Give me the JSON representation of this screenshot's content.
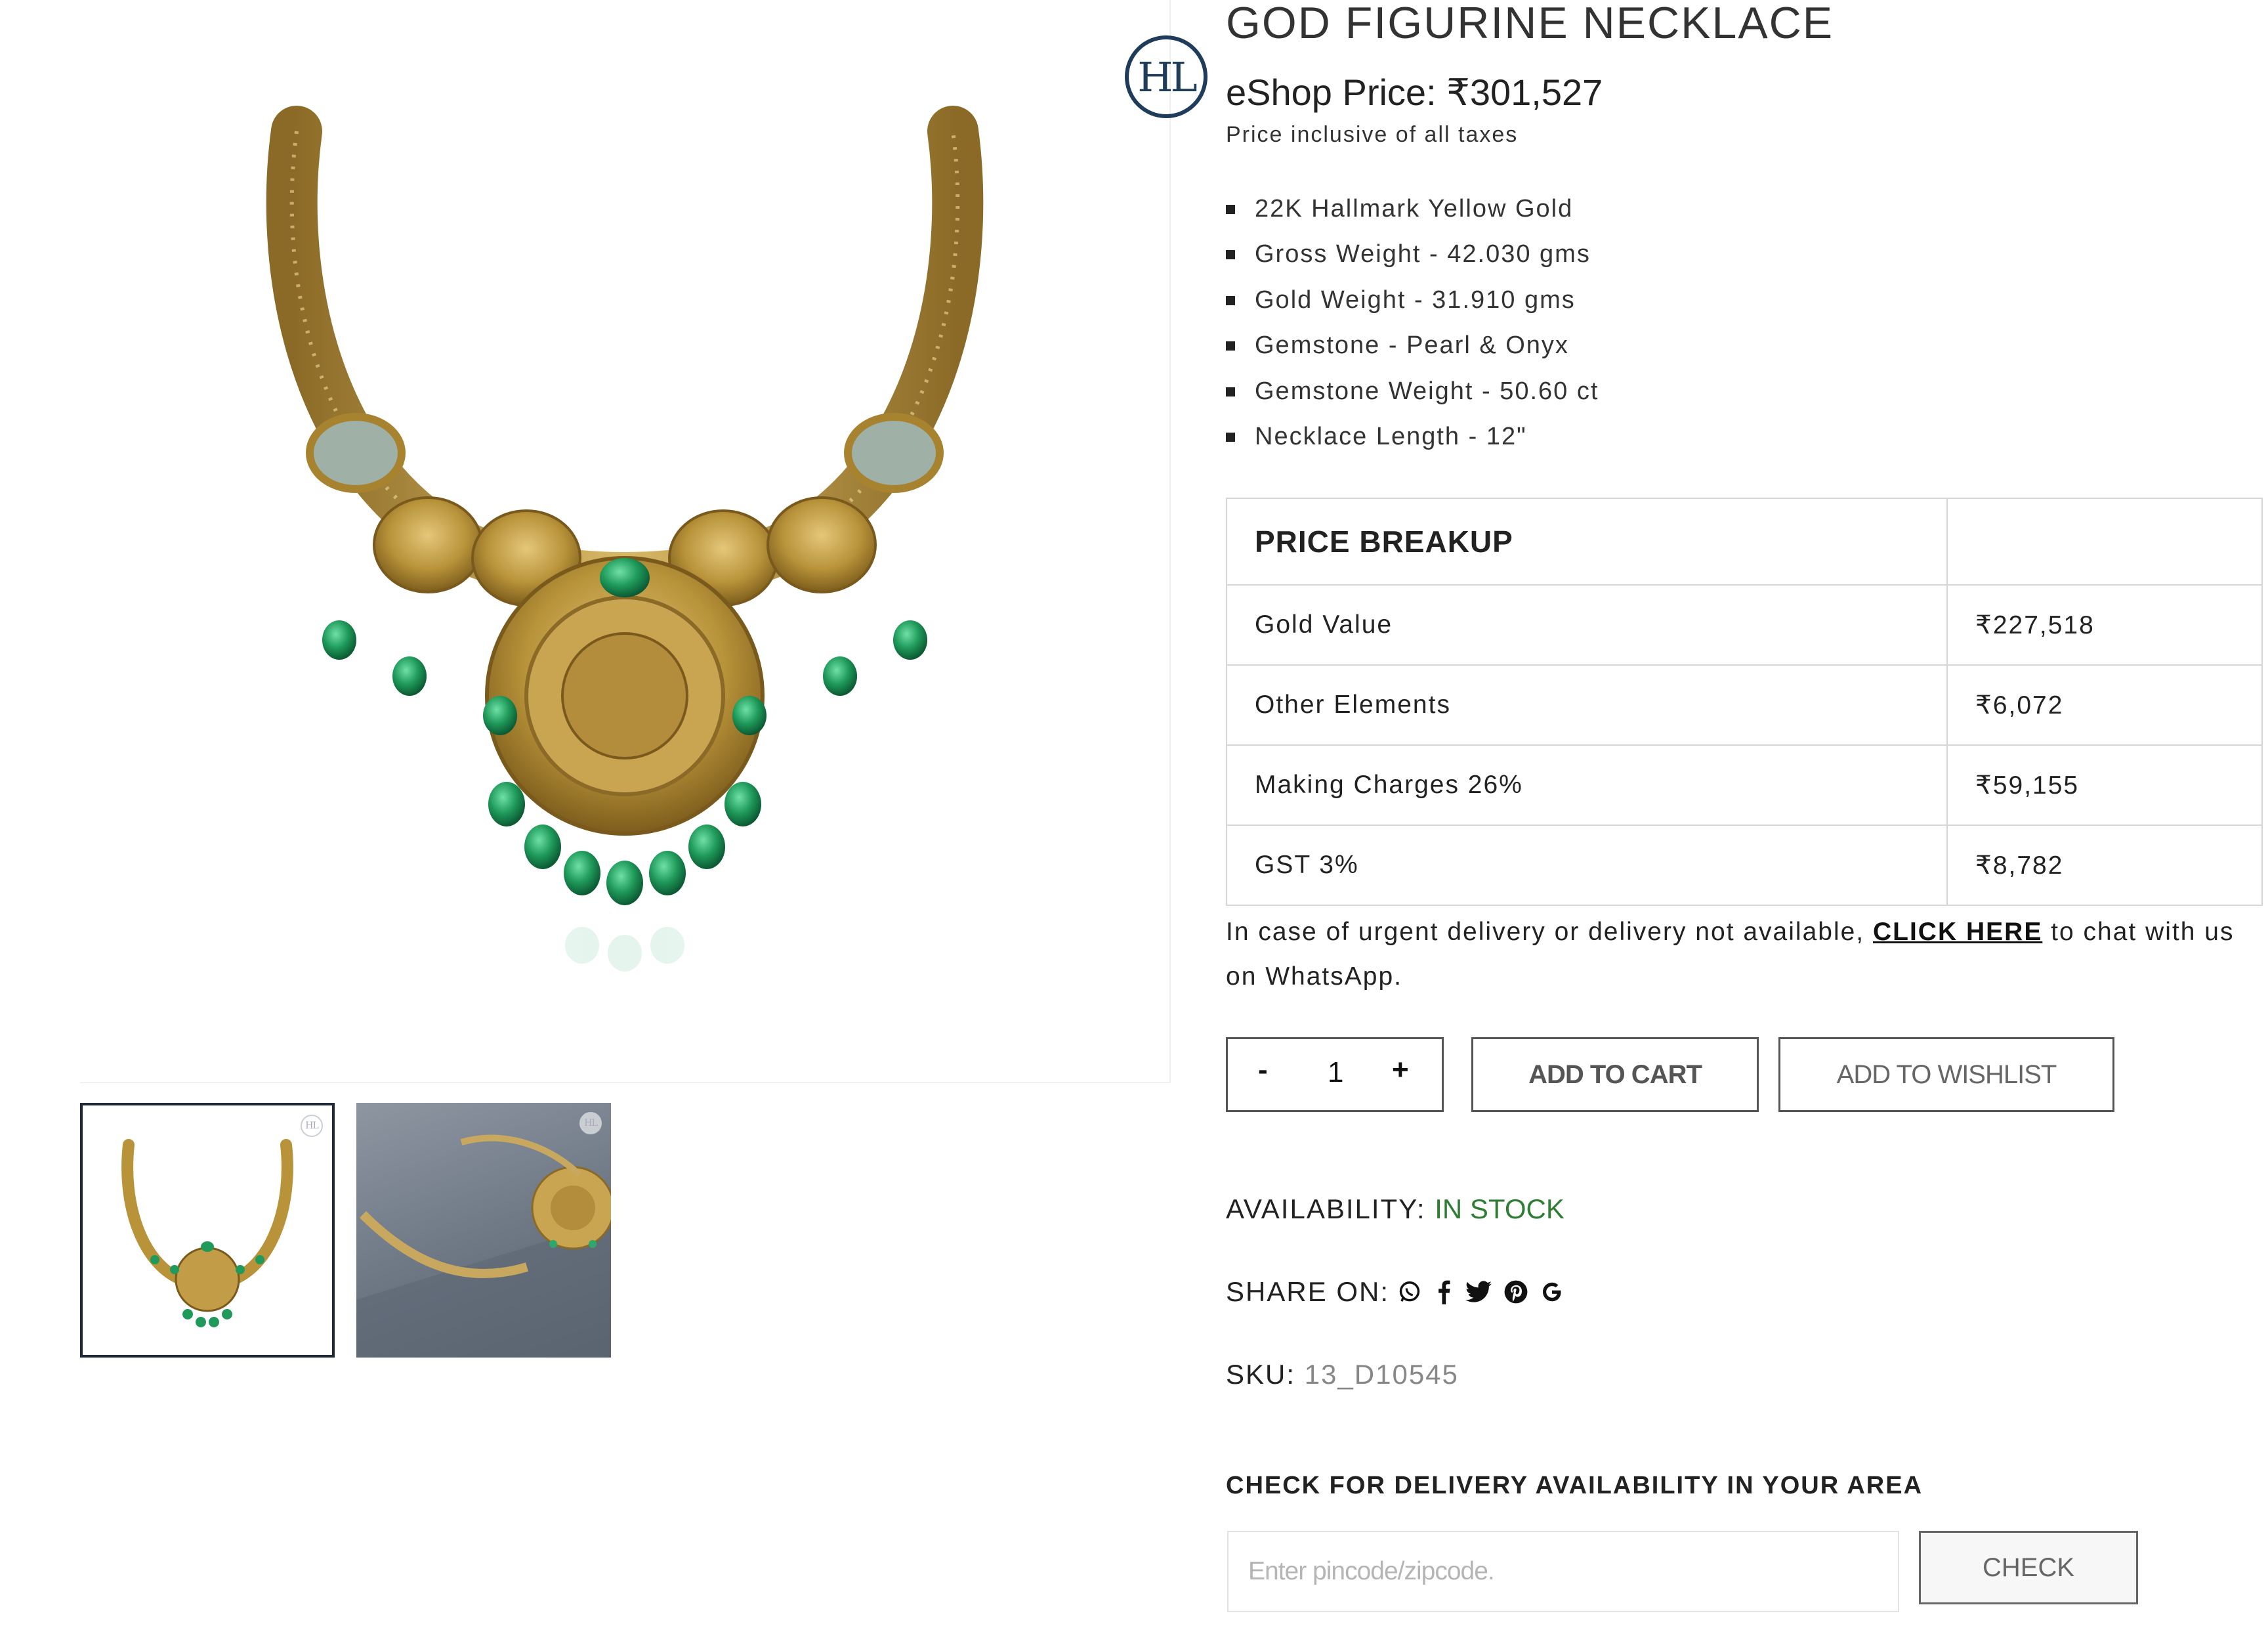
{
  "product": {
    "title": "GOD FIGURINE NECKLACE",
    "price_label": "eShop Price:",
    "price": "₹301,527",
    "price_note": "Price inclusive of all taxes",
    "brand_logo": "HL",
    "features": [
      "22K Hallmark Yellow Gold",
      "Gross Weight - 42.030 gms",
      "Gold Weight - 31.910 gms",
      "Gemstone - Pearl & Onyx",
      "Gemstone Weight - 50.60 ct",
      "Necklace Length - 12\""
    ]
  },
  "gallery": {
    "main_image": "necklace-image",
    "thumbnails": [
      "necklace-front-thumbnail",
      "necklace-angled-thumbnail"
    ],
    "thumb_logo": "HL"
  },
  "price_breakup": {
    "header": "PRICE BREAKUP",
    "rows": [
      {
        "label": "Gold Value",
        "value": "₹227,518"
      },
      {
        "label": "Other Elements",
        "value": "₹6,072"
      },
      {
        "label": "Making Charges 26%",
        "value": "₹59,155"
      },
      {
        "label": "GST 3%",
        "value": "₹8,782"
      }
    ]
  },
  "urgent": {
    "prefix": "In case of urgent delivery or delivery not available, ",
    "link": "CLICK HERE",
    "suffix": " to chat with us on WhatsApp."
  },
  "cart": {
    "minus": "-",
    "quantity": "1",
    "plus": "+",
    "add_to_cart": "ADD TO CART",
    "add_to_wishlist": "ADD TO WISHLIST"
  },
  "availability": {
    "label": "AVAILABILITY:",
    "value": "IN STOCK",
    "color": "#2e7d32"
  },
  "share": {
    "label": "SHARE ON:",
    "icons": [
      "whatsapp-icon",
      "facebook-icon",
      "twitter-icon",
      "pinterest-icon",
      "google-icon"
    ]
  },
  "sku": {
    "label": "SKU:",
    "value": "13_D10545"
  },
  "delivery": {
    "title": "CHECK FOR DELIVERY AVAILABILITY IN YOUR AREA",
    "placeholder": "Enter pincode/zipcode.",
    "button": "CHECK"
  },
  "colors": {
    "gold": "#b8933a",
    "emerald": "#1f9a5a",
    "navy": "#1f3c5a"
  }
}
